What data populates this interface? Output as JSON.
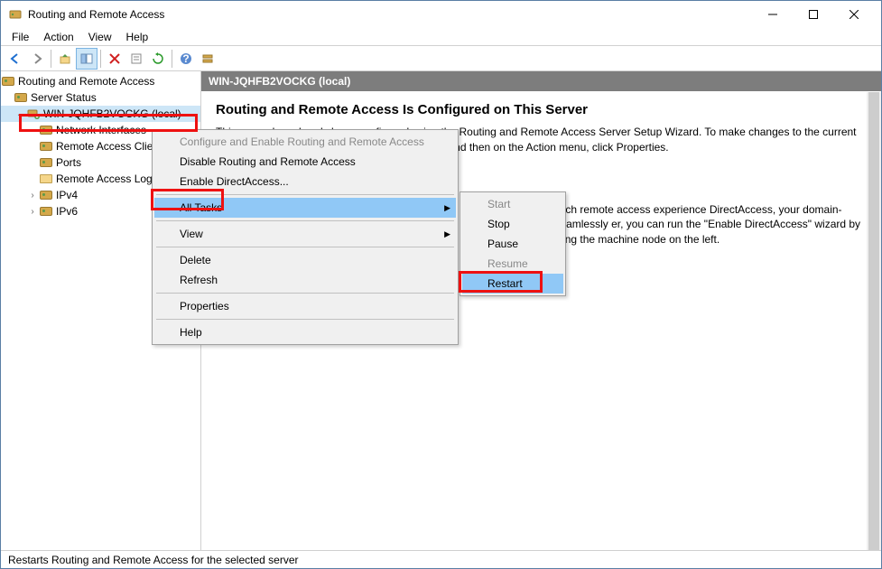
{
  "window": {
    "title": "Routing and Remote Access"
  },
  "menu": {
    "file": "File",
    "action": "Action",
    "view": "View",
    "help": "Help"
  },
  "tree": {
    "root": "Routing and Remote Access",
    "status": "Server Status",
    "server": "WIN-JQHFB2VOCKG (local)",
    "netif": "Network Interfaces",
    "ras": "Remote Access Clients",
    "ports": "Ports",
    "ralog": "Remote Access Logging",
    "ipv4": "IPv4",
    "ipv6": "IPv6"
  },
  "header": "WIN-JQHFB2VOCKG (local)",
  "content": {
    "title": "Routing and Remote Access Is Configured on This Server",
    "p1": "This server has already been configured using the Routing and Remote Access Server Setup Wizard. To make changes to the current configuration, select an item in the console tree, and then on the Action menu, click Properties.",
    "p2": "ients. You can use rich remote access experience DirectAccess, your domain-joined clients can seamlessly er, you can run the \"Enable DirectAccess\" wizard by ight or on right-clicking the machine node on the left."
  },
  "ctx1": {
    "configure": "Configure and Enable Routing and Remote Access",
    "disable": "Disable Routing and Remote Access",
    "enableda": "Enable DirectAccess...",
    "alltasks": "All Tasks",
    "view": "View",
    "delete": "Delete",
    "refresh": "Refresh",
    "properties": "Properties",
    "help": "Help"
  },
  "ctx2": {
    "start": "Start",
    "stop": "Stop",
    "pause": "Pause",
    "resume": "Resume",
    "restart": "Restart"
  },
  "status": "Restarts Routing and Remote Access for the selected server"
}
